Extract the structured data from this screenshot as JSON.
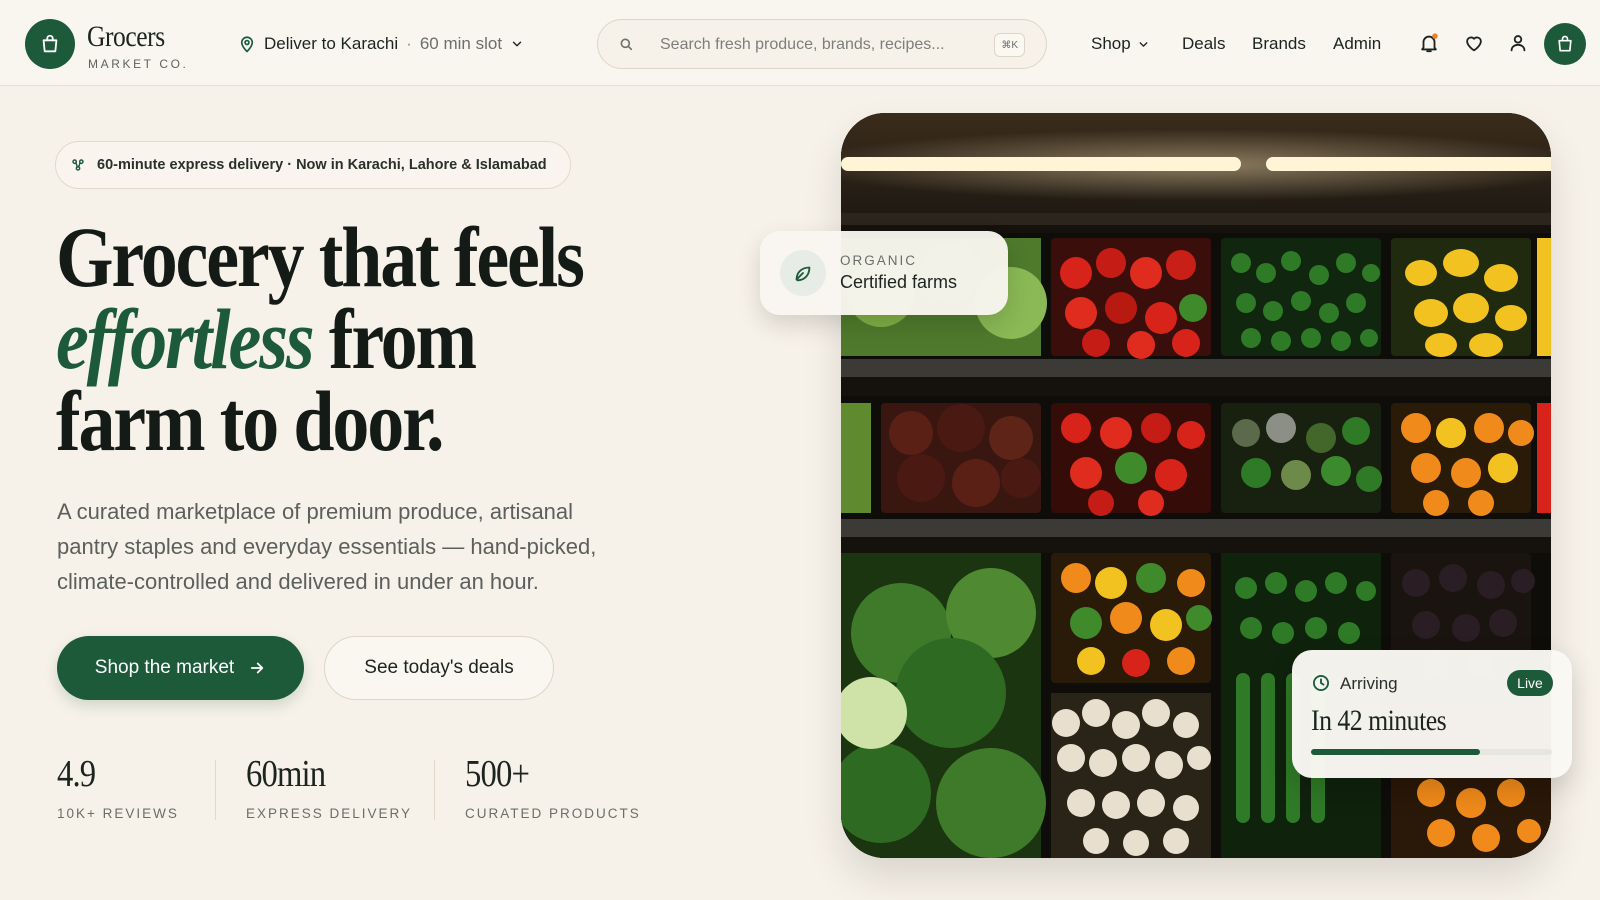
{
  "brand": {
    "name": "Grocers",
    "tagline": "MARKET CO.",
    "logo_icon": "shopping-bag-icon",
    "primary_color": "#1d5a3a",
    "background_color": "#f7f2e9"
  },
  "header": {
    "deliver_label": "Deliver to Karachi",
    "separator": "·",
    "slot_label": "60 min slot",
    "search_placeholder": "Search fresh produce, brands, recipes...",
    "search_shortcut": "⌘K",
    "nav": {
      "shop": "Shop",
      "deals": "Deals",
      "brands": "Brands",
      "admin": "Admin"
    },
    "icons": [
      "bell-icon",
      "heart-icon",
      "user-icon",
      "cart-icon"
    ],
    "notification_dot_color": "#e8832a"
  },
  "hero": {
    "pill_text": "60-minute express delivery · Now in Karachi, Lahore & Islamabad",
    "headline_line1": "Grocery that feels",
    "headline_accent": "effortless",
    "headline_line2_rest": " from",
    "headline_line3": "farm to door.",
    "lede": "A curated marketplace of premium produce, artisanal pantry staples and everyday essentials — hand-picked, climate-controlled and delivered in under an hour.",
    "primary_cta": "Shop the market",
    "secondary_cta": "See today's deals",
    "stats": [
      {
        "value": "4.9",
        "label": "10K+ REVIEWS"
      },
      {
        "value": "60min",
        "label": "EXPRESS DELIVERY"
      },
      {
        "value": "500+",
        "label": "CURATED PRODUCTS"
      }
    ]
  },
  "image_card": {
    "organic_kicker": "ORGANIC",
    "organic_title": "Certified farms",
    "arriving_label": "Arriving",
    "live_badge": "Live",
    "arriving_time": "In 42 minutes",
    "delivery_progress": 0.7
  }
}
